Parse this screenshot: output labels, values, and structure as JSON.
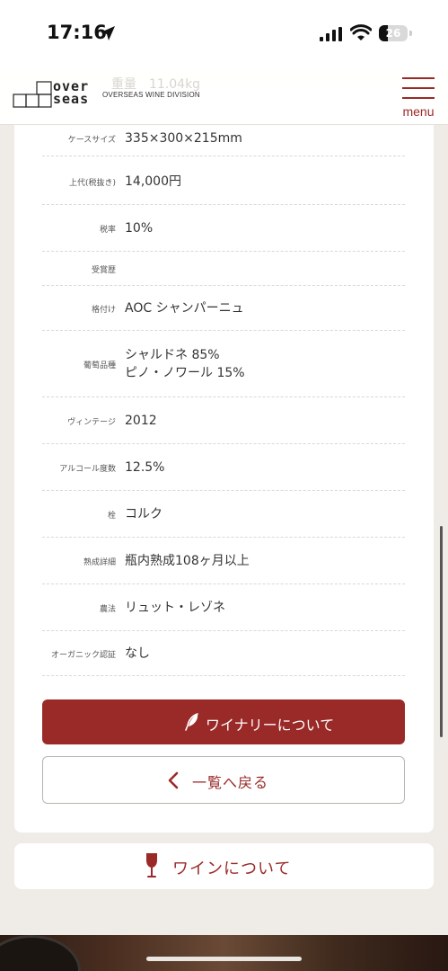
{
  "status_bar": {
    "time": "17:16",
    "battery": "26"
  },
  "header": {
    "logo_line1": "over",
    "logo_line2": "seas",
    "logo_sub": "OVERSEAS WINE DIVISION",
    "menu_label": "menu",
    "ghost_text": "重量　11.04kg",
    "accent_color": "#9a2a28"
  },
  "specs": [
    {
      "label": "ケースサイズ",
      "value": "335×300×215mm"
    },
    {
      "label": "上代(税抜き)",
      "value": "14,000円"
    },
    {
      "label": "税率",
      "value": "10%"
    },
    {
      "label": "受賞歴",
      "value": ""
    },
    {
      "label": "格付け",
      "value": "AOC シャンパーニュ"
    },
    {
      "label": "葡萄品種",
      "value": "シャルドネ 85%",
      "value2": "ピノ・ノワール 15%"
    },
    {
      "label": "ヴィンテージ",
      "value": "2012"
    },
    {
      "label": "アルコール度数",
      "value": "12.5%"
    },
    {
      "label": "栓",
      "value": "コルク"
    },
    {
      "label": "熟成詳細",
      "value": "瓶内熟成108ヶ月以上"
    },
    {
      "label": "農法",
      "value": "リュット・レゾネ"
    },
    {
      "label": "オーガニック認証",
      "value": "なし"
    }
  ],
  "buttons": {
    "winery": "ワイナリーについて",
    "back": "一覧へ戻る",
    "about_wine": "ワインについて"
  },
  "icons": {
    "feather": "feather-icon",
    "chevron": "chevron-left-icon",
    "glass": "wine-glass-icon"
  }
}
